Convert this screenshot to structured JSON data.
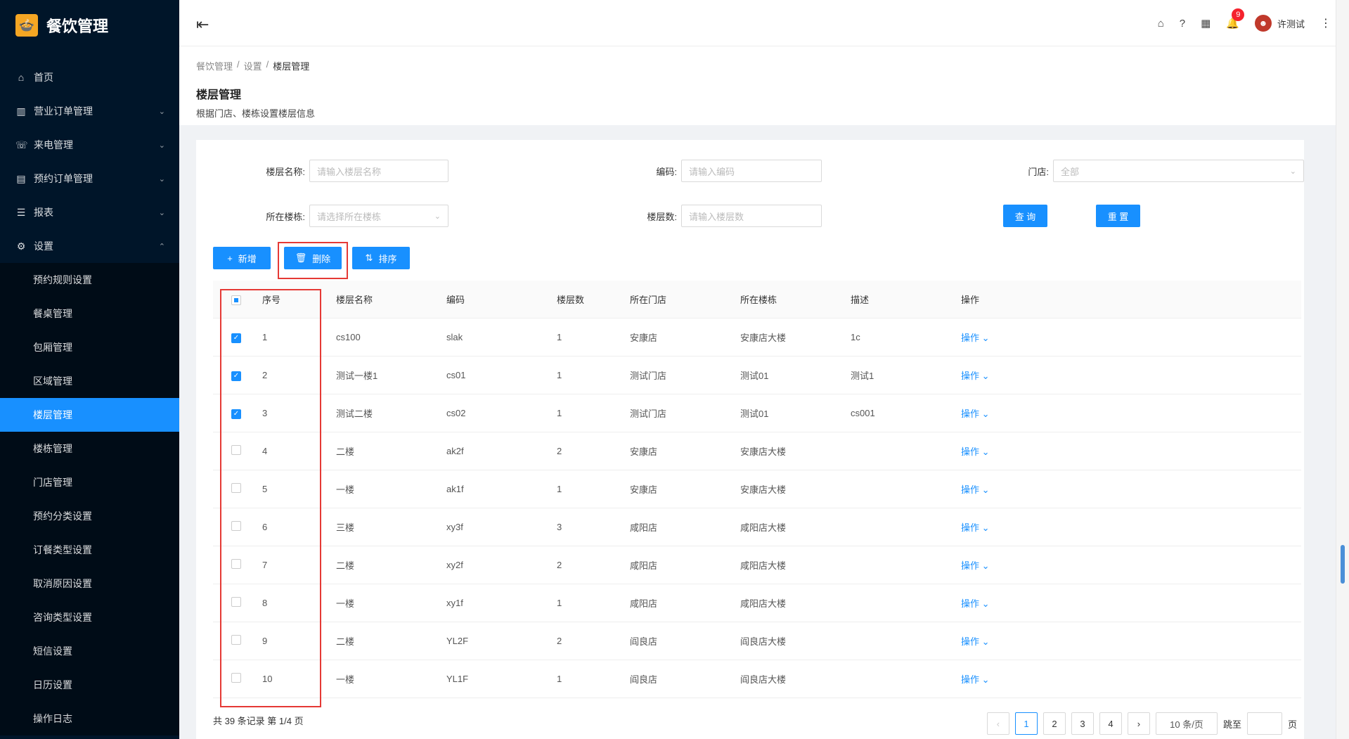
{
  "app": {
    "name": "餐饮管理"
  },
  "sidebar": {
    "items": [
      {
        "label": "首页",
        "icon": "home-icon",
        "glyph": "⌂"
      },
      {
        "label": "营业订单管理",
        "icon": "chart-icon",
        "glyph": "▥",
        "arrow": "⌄"
      },
      {
        "label": "来电管理",
        "icon": "phone-icon",
        "glyph": "☏",
        "arrow": "⌄"
      },
      {
        "label": "预约订单管理",
        "icon": "list-icon",
        "glyph": "▤",
        "arrow": "⌄"
      },
      {
        "label": "报表",
        "icon": "menu-icon",
        "glyph": "☰",
        "arrow": "⌄"
      },
      {
        "label": "设置",
        "icon": "gear-icon",
        "glyph": "⚙",
        "arrow": "⌃"
      }
    ],
    "sub_items": [
      "预约规则设置",
      "餐桌管理",
      "包厢管理",
      "区域管理",
      "楼层管理",
      "楼栋管理",
      "门店管理",
      "预约分类设置",
      "订餐类型设置",
      "取消原因设置",
      "咨询类型设置",
      "短信设置",
      "日历设置",
      "操作日志"
    ],
    "active_sub": "楼层管理"
  },
  "header": {
    "notification_count": "9",
    "username": "许测试"
  },
  "breadcrumb": [
    "餐饮管理",
    "设置",
    "楼层管理"
  ],
  "page": {
    "title": "楼层管理",
    "desc": "根据门店、楼栋设置楼层信息"
  },
  "filters": {
    "floor_name": {
      "label": "楼层名称:",
      "placeholder": "请输入楼层名称"
    },
    "code": {
      "label": "编码:",
      "placeholder": "请输入编码"
    },
    "store": {
      "label": "门店:",
      "value": "全部"
    },
    "building": {
      "label": "所在楼栋:",
      "placeholder": "请选择所在楼栋"
    },
    "floor_count": {
      "label": "楼层数:",
      "placeholder": "请输入楼层数"
    },
    "query_label": "查 询",
    "reset_label": "重 置"
  },
  "toolbar": {
    "add_label": "新增",
    "delete_label": "删除",
    "sort_label": "排序"
  },
  "table": {
    "headers": [
      "序号",
      "楼层名称",
      "编码",
      "楼层数",
      "所在门店",
      "所在楼栋",
      "描述",
      "操作"
    ],
    "rows": [
      {
        "checked": true,
        "no": "1",
        "name": "cs100",
        "code": "slak",
        "floors": "1",
        "store": "安康店",
        "building": "安康店大楼",
        "desc": "1c",
        "op": "操作"
      },
      {
        "checked": true,
        "no": "2",
        "name": "测试一楼1",
        "code": "cs01",
        "floors": "1",
        "store": "测试门店",
        "building": "测试01",
        "desc": "测试1",
        "op": "操作"
      },
      {
        "checked": true,
        "no": "3",
        "name": "测试二楼",
        "code": "cs02",
        "floors": "1",
        "store": "测试门店",
        "building": "测试01",
        "desc": "cs001",
        "op": "操作"
      },
      {
        "checked": false,
        "no": "4",
        "name": "二楼",
        "code": "ak2f",
        "floors": "2",
        "store": "安康店",
        "building": "安康店大楼",
        "desc": "",
        "op": "操作"
      },
      {
        "checked": false,
        "no": "5",
        "name": "一楼",
        "code": "ak1f",
        "floors": "1",
        "store": "安康店",
        "building": "安康店大楼",
        "desc": "",
        "op": "操作"
      },
      {
        "checked": false,
        "no": "6",
        "name": "三楼",
        "code": "xy3f",
        "floors": "3",
        "store": "咸阳店",
        "building": "咸阳店大楼",
        "desc": "",
        "op": "操作"
      },
      {
        "checked": false,
        "no": "7",
        "name": "二楼",
        "code": "xy2f",
        "floors": "2",
        "store": "咸阳店",
        "building": "咸阳店大楼",
        "desc": "",
        "op": "操作"
      },
      {
        "checked": false,
        "no": "8",
        "name": "一楼",
        "code": "xy1f",
        "floors": "1",
        "store": "咸阳店",
        "building": "咸阳店大楼",
        "desc": "",
        "op": "操作"
      },
      {
        "checked": false,
        "no": "9",
        "name": "二楼",
        "code": "YL2F",
        "floors": "2",
        "store": "阎良店",
        "building": "阎良店大楼",
        "desc": "",
        "op": "操作"
      },
      {
        "checked": false,
        "no": "10",
        "name": "一楼",
        "code": "YL1F",
        "floors": "1",
        "store": "阎良店",
        "building": "阎良店大楼",
        "desc": "",
        "op": "操作"
      }
    ]
  },
  "footer": {
    "summary": "共 39 条记录 第 1/4 页",
    "pages": [
      "1",
      "2",
      "3",
      "4"
    ],
    "page_size": "10 条/页",
    "jump_label": "跳至",
    "page_unit": "页"
  }
}
